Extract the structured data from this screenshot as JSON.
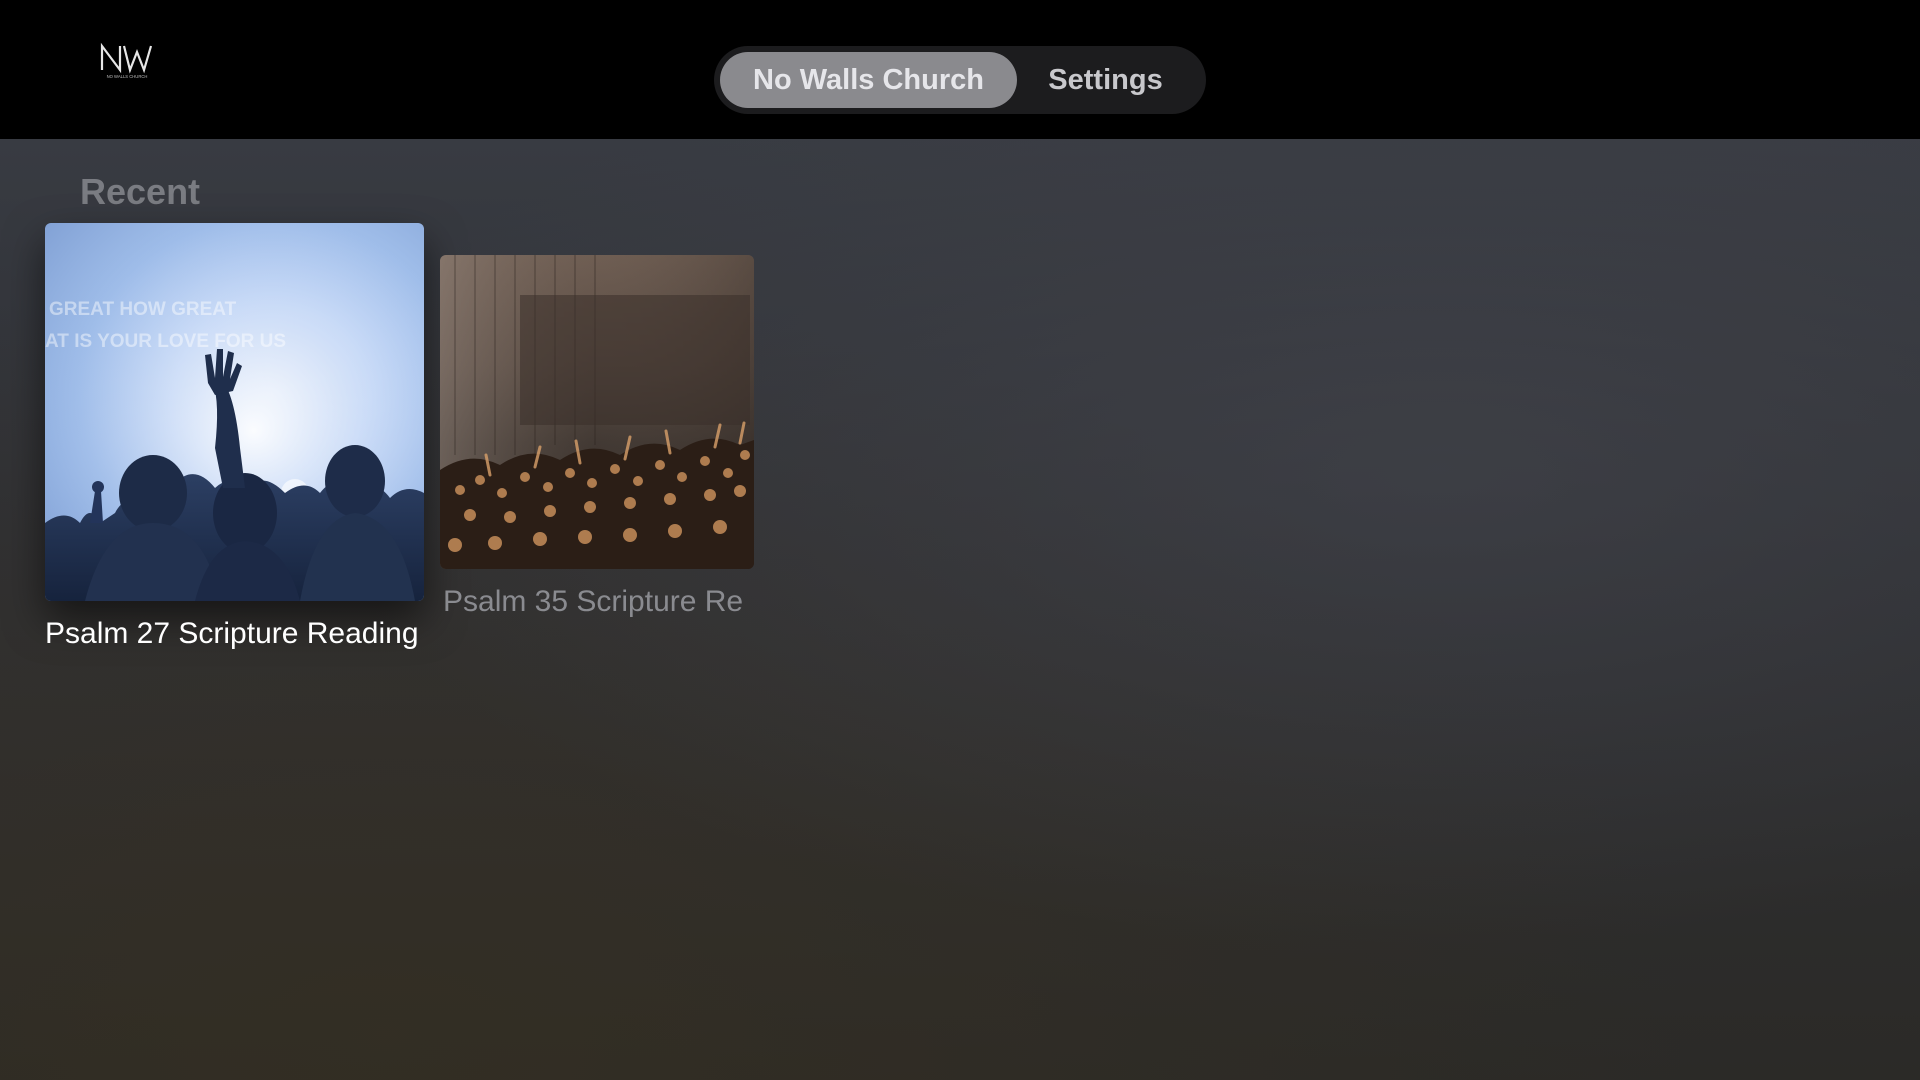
{
  "app": {
    "logo_text": "NW",
    "logo_subtext": "NO WALLS CHURCH"
  },
  "tabs": [
    {
      "label": "No Walls Church",
      "selected": true
    },
    {
      "label": "Settings",
      "selected": false
    }
  ],
  "recent": {
    "title": "Recent",
    "items": [
      {
        "title": "Psalm 27 Scripture Reading",
        "focused": true,
        "thumbnail_overlay_lines": [
          "GREAT HOW GREAT",
          "AT IS YOUR LOVE FOR US"
        ]
      },
      {
        "title": "Psalm 35 Scripture Re",
        "focused": false
      }
    ]
  },
  "colors": {
    "topbar": "#000000",
    "tab_selected": "#8a8a8e",
    "tab_bar": "#1c1c1e",
    "background_top": "#383b42",
    "background_bottom": "#2b2a27"
  }
}
